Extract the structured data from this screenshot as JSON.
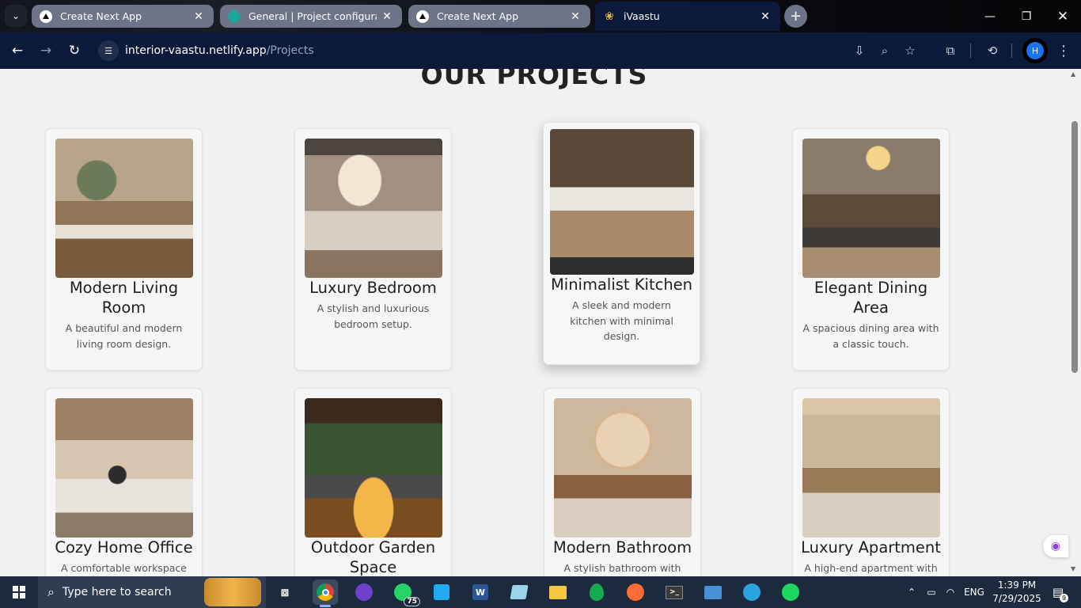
{
  "browser": {
    "tabs": [
      {
        "title": "Create Next App",
        "favicon": "vercel-icon"
      },
      {
        "title": "General | Project configuration",
        "favicon": "teal-diamond-icon"
      },
      {
        "title": "Create Next App",
        "favicon": "vercel-icon"
      },
      {
        "title": "iVaastu",
        "favicon": "lotus-icon",
        "active": true
      }
    ],
    "url_host": "interior-vaastu.netlify.app",
    "url_path": "/Projects",
    "profile_initial": "H"
  },
  "page": {
    "heading": "OUR PROJECTS",
    "projects": [
      {
        "title": "Modern Living Room",
        "desc": "A beautiful and modern living room design."
      },
      {
        "title": "Luxury Bedroom",
        "desc": "A stylish and luxurious bedroom setup."
      },
      {
        "title": "Minimalist Kitchen",
        "desc": "A sleek and modern kitchen with minimal design."
      },
      {
        "title": "Elegant Dining Area",
        "desc": "A spacious dining area with a classic touch."
      },
      {
        "title": "Cozy Home Office",
        "desc": "A comfortable workspace with"
      },
      {
        "title": "Outdoor Garden Space",
        "desc": ""
      },
      {
        "title": "Modern Bathroom",
        "desc": "A stylish bathroom with"
      },
      {
        "title": "Luxury Apartment",
        "desc": "A high-end apartment with"
      }
    ]
  },
  "taskbar": {
    "search_placeholder": "Type here to search",
    "whatsapp_badge": "75",
    "language": "ENG",
    "time": "1:39 PM",
    "date": "7/29/2025",
    "notification_count": "9"
  }
}
